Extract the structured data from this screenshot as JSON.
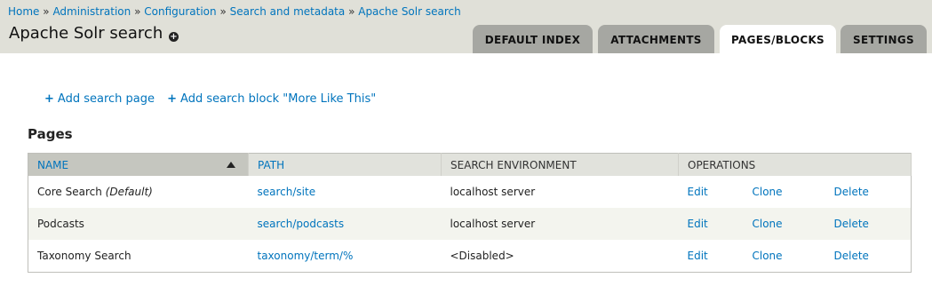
{
  "breadcrumb": {
    "items": [
      "Home",
      "Administration",
      "Configuration",
      "Search and metadata",
      "Apache Solr search"
    ],
    "separator": "»"
  },
  "page_title": "Apache Solr search",
  "tabs": [
    {
      "label": "DEFAULT INDEX",
      "active": false
    },
    {
      "label": "ATTACHMENTS",
      "active": false
    },
    {
      "label": "PAGES/BLOCKS",
      "active": true
    },
    {
      "label": "SETTINGS",
      "active": false
    }
  ],
  "actions": {
    "add_page": "Add search page",
    "add_block": "Add search block \"More Like This\""
  },
  "pages_section": {
    "title": "Pages",
    "columns": [
      "NAME",
      "PATH",
      "SEARCH ENVIRONMENT",
      "OPERATIONS"
    ],
    "rows": [
      {
        "name": "Core Search",
        "note": "(Default)",
        "path": "search/site",
        "environment": "localhost server",
        "ops": [
          "Edit",
          "Clone",
          "Delete"
        ]
      },
      {
        "name": "Podcasts",
        "note": "",
        "path": "search/podcasts",
        "environment": "localhost server",
        "ops": [
          "Edit",
          "Clone",
          "Delete"
        ]
      },
      {
        "name": "Taxonomy Search",
        "note": "",
        "path": "taxonomy/term/%",
        "environment": "<Disabled>",
        "ops": [
          "Edit",
          "Clone",
          "Delete"
        ]
      }
    ]
  },
  "colors": {
    "link": "#0074bd",
    "header_bg": "#e0e0d8",
    "tab_bg": "#a6a7a2"
  }
}
